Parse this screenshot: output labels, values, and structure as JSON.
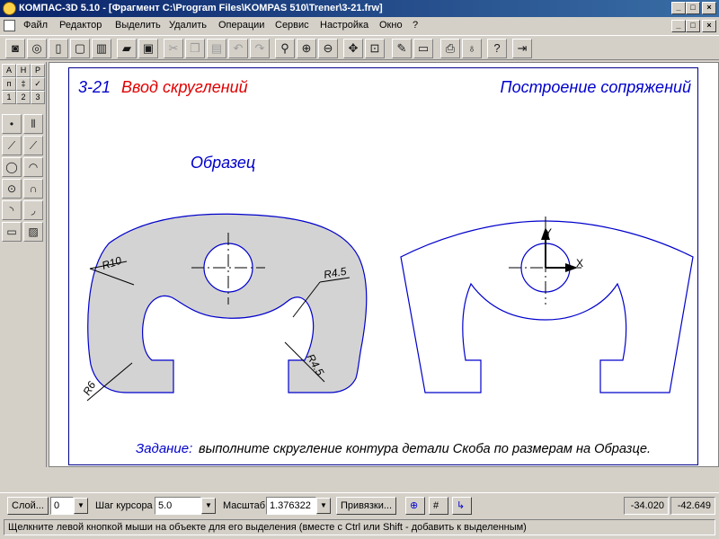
{
  "window": {
    "title": "КОМПАС-3D 5.10 - [Фрагмент C:\\Program Files\\KOMPAS 510\\Trener\\3-21.frw]"
  },
  "menu": {
    "items": [
      "Файл",
      "Редактор",
      "Выделить",
      "Удалить",
      "Операции",
      "Сервис",
      "Настройка",
      "Окно",
      "?"
    ]
  },
  "icons": {
    "toolbar": [
      "new-doc-icon",
      "open-icon",
      "blank-doc-icon",
      "page-icon",
      "layout-icon",
      "folder-icon",
      "save-icon",
      "cut-icon",
      "copy-icon",
      "paste-icon",
      "undo-icon",
      "redo-icon",
      "zoom-icon",
      "zoom-in-icon",
      "zoom-out-icon",
      "pan-icon",
      "fit-icon",
      "pencil-icon",
      "frame-icon",
      "print-icon",
      "stamp-icon",
      "help-icon",
      "exit-icon"
    ]
  },
  "drawing": {
    "exercise_number": "3-21",
    "exercise_title": "Ввод скруглений",
    "section_title": "Построение сопряжений",
    "sample_label": "Образец",
    "dims": {
      "r10": "R10",
      "r45_top": "R4.5",
      "r45_bottom": "R4.5",
      "r6": "R6"
    },
    "axis_y": "Y",
    "axis_x": "X",
    "task_label": "Задание:",
    "task_text": "выполните скругление контура детали Скоба по размерам на Образце."
  },
  "statusbar": {
    "layer_button": "Слой...",
    "layer_value": "0",
    "cursor_step_label": "Шаг курсора",
    "cursor_step_value": "5.0",
    "scale_label": "Масштаб",
    "scale_value": "1.376322",
    "snaps_button": "Привязки...",
    "coord_x": "-34.020",
    "coord_y": "-42.649"
  },
  "hint": {
    "text": "Щелкните левой кнопкой мыши на объекте для его выделения (вместе с Ctrl или Shift - добавить к выделенным)"
  },
  "colors": {
    "title_blue": "#0000cc",
    "title_red": "#e00000",
    "part_fill": "#d3d3d3",
    "line_blue": "#0000cc"
  }
}
